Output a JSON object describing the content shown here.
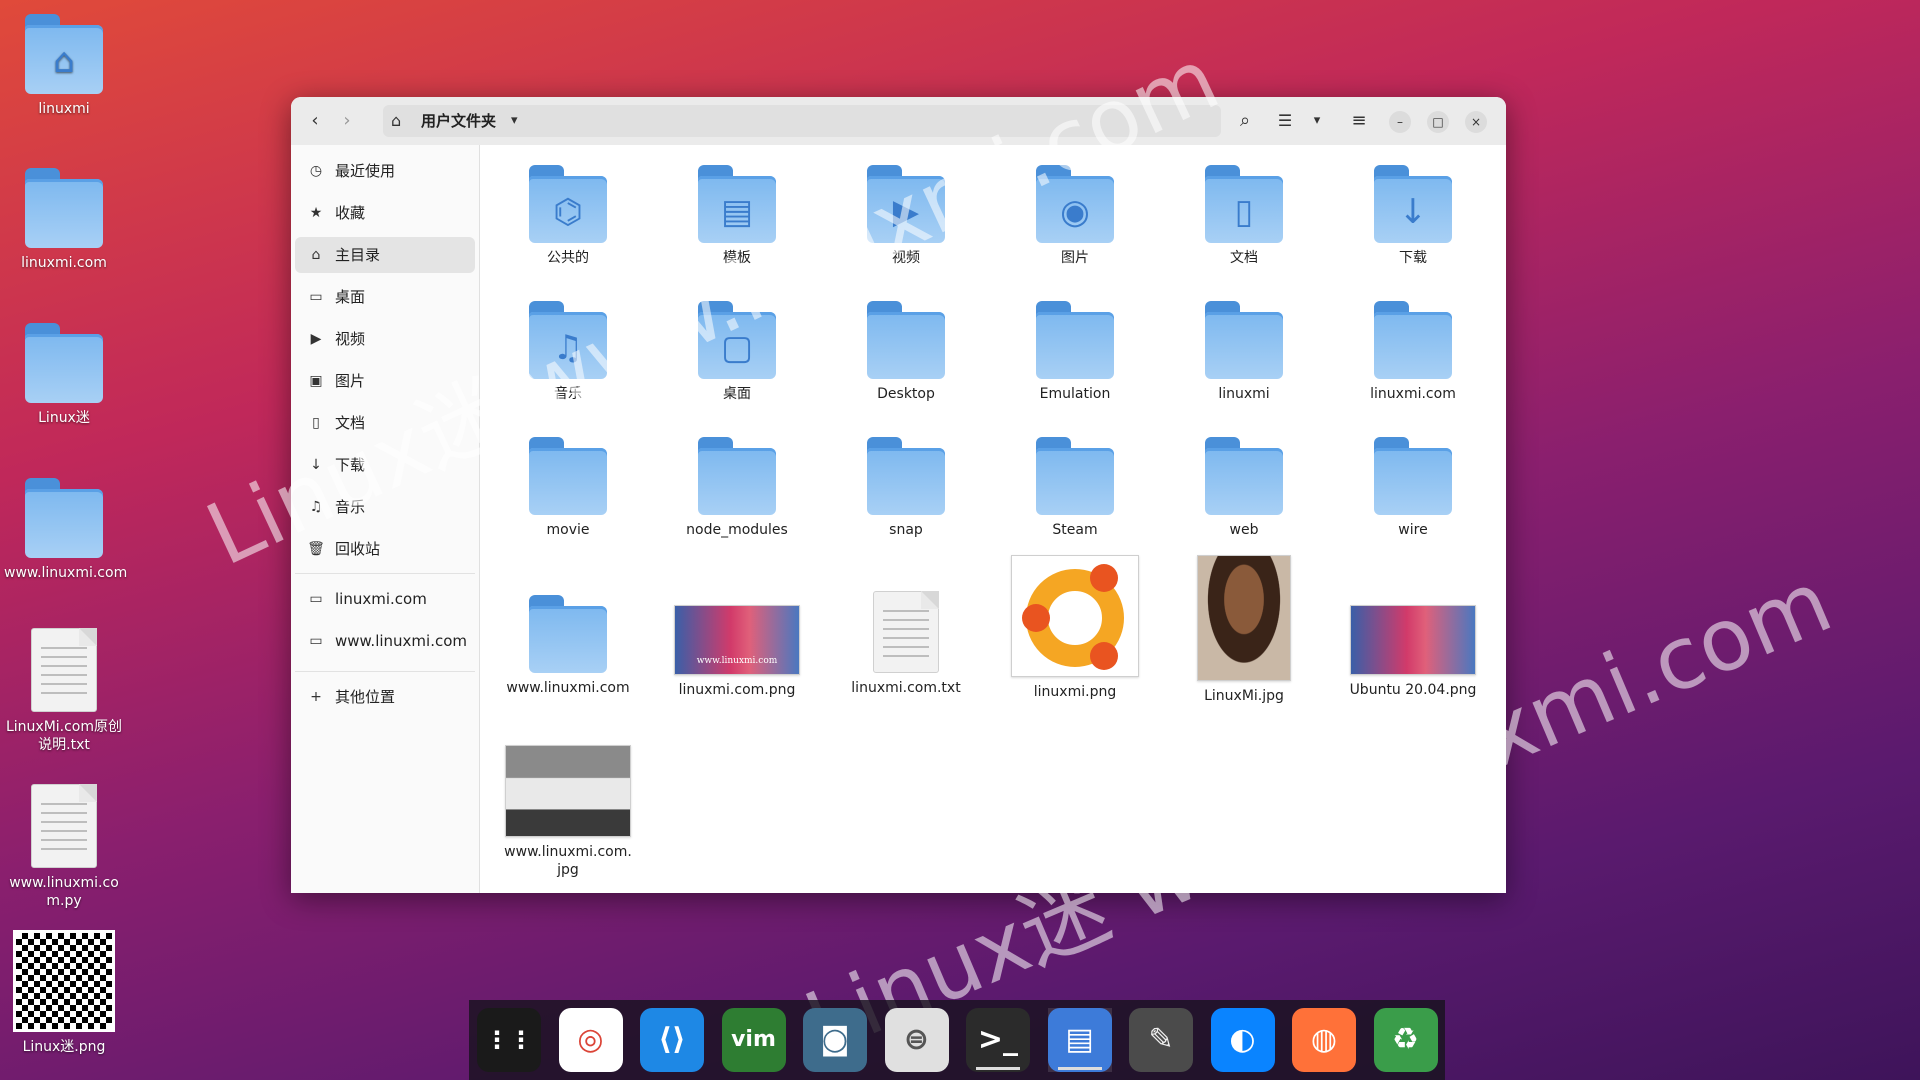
{
  "desktop": {
    "icons": [
      {
        "label": "linuxmi"
      },
      {
        "label": "linuxmi.com"
      },
      {
        "label": "Linux迷"
      },
      {
        "label": "www.linuxmi.com"
      },
      {
        "label": "LinuxMi.com原创\n说明.txt"
      },
      {
        "label": "www.linuxmi.co\nm.py"
      },
      {
        "label": "Linux迷.png"
      }
    ]
  },
  "window": {
    "nav": {
      "back": "‹",
      "forward": "›"
    },
    "path": {
      "home_icon": "home-icon",
      "label": "用户文件夹",
      "caret": "▾"
    },
    "toolbar": {
      "search": "⌕",
      "view": "☰",
      "view_caret": "▾",
      "menu": "≡",
      "minimize": "–",
      "maximize": "□",
      "close": "×"
    }
  },
  "sidebar": {
    "items": [
      {
        "icon": "clock-icon",
        "glyph": "◷",
        "label": "最近使用"
      },
      {
        "icon": "star-icon",
        "glyph": "★",
        "label": "收藏"
      },
      {
        "icon": "home-icon",
        "glyph": "⌂",
        "label": "主目录"
      },
      {
        "icon": "folder-icon",
        "glyph": "▭",
        "label": "桌面"
      },
      {
        "icon": "video-icon",
        "glyph": "▶",
        "label": "视频"
      },
      {
        "icon": "image-icon",
        "glyph": "▣",
        "label": "图片"
      },
      {
        "icon": "document-icon",
        "glyph": "▯",
        "label": "文档"
      },
      {
        "icon": "download-icon",
        "glyph": "↓",
        "label": "下载"
      },
      {
        "icon": "music-icon",
        "glyph": "♫",
        "label": "音乐"
      },
      {
        "icon": "trash-icon",
        "glyph": "🗑",
        "label": "回收站"
      }
    ],
    "bookmarks": [
      {
        "icon": "folder-icon",
        "glyph": "▭",
        "label": "linuxmi.com"
      },
      {
        "icon": "folder-icon",
        "glyph": "▭",
        "label": "www.linuxmi.com"
      }
    ],
    "other": {
      "glyph": "+",
      "label": "其他位置"
    }
  },
  "files": [
    {
      "name": "公共的",
      "kind": "folder",
      "glyph": "⌬",
      "icon": "share-icon"
    },
    {
      "name": "模板",
      "kind": "folder",
      "glyph": "▤",
      "icon": "template-icon"
    },
    {
      "name": "视频",
      "kind": "folder",
      "glyph": "▶",
      "icon": "video-icon"
    },
    {
      "name": "图片",
      "kind": "folder",
      "glyph": "◉",
      "icon": "camera-icon"
    },
    {
      "name": "文档",
      "kind": "folder",
      "glyph": "▯",
      "icon": "document-icon"
    },
    {
      "name": "下载",
      "kind": "folder",
      "glyph": "↓",
      "icon": "download-icon"
    },
    {
      "name": "音乐",
      "kind": "folder",
      "glyph": "♫",
      "icon": "music-icon"
    },
    {
      "name": "桌面",
      "kind": "folder",
      "glyph": "▢",
      "icon": "desktop-icon"
    },
    {
      "name": "Desktop",
      "kind": "folder",
      "glyph": "",
      "icon": "folder-icon"
    },
    {
      "name": "Emulation",
      "kind": "folder",
      "glyph": "",
      "icon": "folder-icon"
    },
    {
      "name": "linuxmi",
      "kind": "folder",
      "glyph": "",
      "icon": "folder-icon"
    },
    {
      "name": "linuxmi.com",
      "kind": "folder",
      "glyph": "",
      "icon": "folder-icon"
    },
    {
      "name": "movie",
      "kind": "folder",
      "glyph": "",
      "icon": "folder-icon"
    },
    {
      "name": "node_modules",
      "kind": "folder",
      "glyph": "",
      "icon": "folder-icon"
    },
    {
      "name": "snap",
      "kind": "folder",
      "glyph": "",
      "icon": "folder-icon"
    },
    {
      "name": "Steam",
      "kind": "folder",
      "glyph": "",
      "icon": "folder-icon"
    },
    {
      "name": "web",
      "kind": "folder",
      "glyph": "",
      "icon": "folder-icon"
    },
    {
      "name": "wire",
      "kind": "folder",
      "glyph": "",
      "icon": "folder-icon"
    },
    {
      "name": "www.linuxmi.com",
      "kind": "folder",
      "glyph": "",
      "icon": "folder-icon"
    },
    {
      "name": "linuxmi.com.png",
      "kind": "thumb-pink",
      "caption": "www.linuxmi.com"
    },
    {
      "name": "linuxmi.com.txt",
      "kind": "text"
    },
    {
      "name": "linuxmi.png",
      "kind": "thumb-ubuntu"
    },
    {
      "name": "LinuxMi.jpg",
      "kind": "thumb-portrait"
    },
    {
      "name": "Ubuntu 20.04.png",
      "kind": "thumb-pink",
      "caption": ""
    },
    {
      "name": "www.linuxmi.com.\njpg",
      "kind": "thumb-car"
    }
  ],
  "watermarks": [
    "Linux迷 www.linuxmi.com",
    "Linux迷 www.linuxmi.com"
  ],
  "dock": {
    "apps": [
      {
        "name": "show-apps",
        "glyph": "⋮⋮"
      },
      {
        "name": "chrome",
        "glyph": "◎"
      },
      {
        "name": "vscode",
        "glyph": "⟨⟩"
      },
      {
        "name": "vim",
        "glyph": "vim"
      },
      {
        "name": "screenshot",
        "glyph": "◙"
      },
      {
        "name": "tweaks",
        "glyph": "⊜"
      },
      {
        "name": "terminal",
        "glyph": ">_"
      },
      {
        "name": "files",
        "glyph": "▤"
      },
      {
        "name": "gimp",
        "glyph": "✎"
      },
      {
        "name": "edge",
        "glyph": "◐"
      },
      {
        "name": "firefox",
        "glyph": "◍"
      },
      {
        "name": "trash",
        "glyph": "♻"
      }
    ]
  },
  "colors": {
    "folder_light": "#a8d0f5",
    "folder_dark": "#4a90d9",
    "sidebar_active": "#e4e4e4"
  }
}
